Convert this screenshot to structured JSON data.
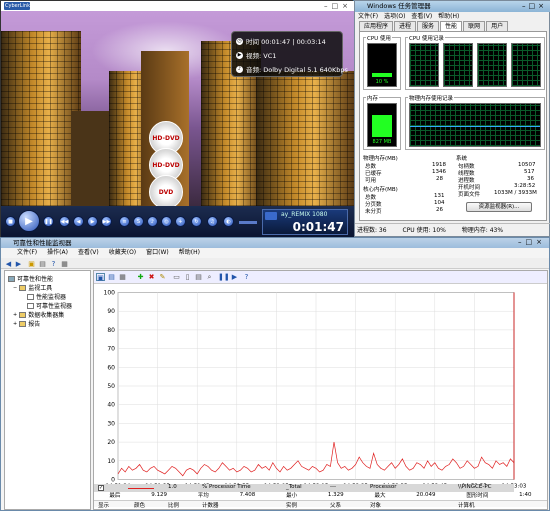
{
  "player": {
    "logo": "CyberLink",
    "osd": {
      "time": "时间 00:01:47 | 00:03:14",
      "video": "视频: VC1",
      "audio": "音频: Dolby Digital 5.1   640Kbps"
    },
    "discs": [
      "HD-DVD",
      "HD-DVD",
      "DVD"
    ],
    "time_panel": {
      "title": "ay_REMIX 1080",
      "time": "0:01:47"
    }
  },
  "taskmgr": {
    "title": "Windows 任务管理器",
    "menu": [
      "文件(F)",
      "选项(O)",
      "查看(V)",
      "帮助(H)"
    ],
    "tabs": [
      "应用程序",
      "进程",
      "服务",
      "性能",
      "联网",
      "用户"
    ],
    "active_tab": "性能",
    "cpu_usage_label": "CPU 使用",
    "cpu_history_label": "CPU 使用记录",
    "cpu_value": "10 %",
    "mem_label": "内存",
    "mem_history_label": "物理内存使用记录",
    "mem_value": "827 MB",
    "phys_mem": {
      "title": "物理内存(MB)",
      "rows": [
        [
          "总数",
          "1918"
        ],
        [
          "已缓存",
          "1346"
        ],
        [
          "可用",
          "28"
        ]
      ]
    },
    "kernel_mem": {
      "title": "核心内存(MB)",
      "rows": [
        [
          "总数",
          "131"
        ],
        [
          "分页数",
          "104"
        ],
        [
          "未分页",
          "26"
        ]
      ]
    },
    "system": {
      "title": "系统",
      "rows": [
        [
          "句柄数",
          "10507"
        ],
        [
          "线程数",
          "517"
        ],
        [
          "进程数",
          "36"
        ],
        [
          "开机时间",
          "3:28:52"
        ],
        [
          "页面文件",
          "1033M / 3933M"
        ]
      ]
    },
    "resmon_button": "资源监视器(R)...",
    "status": [
      "进程数: 36",
      "CPU 使用: 10%",
      "物理内存: 43%"
    ]
  },
  "perfmon": {
    "title": "可靠性和性能监视器",
    "menu": [
      "文件(F)",
      "操作(A)",
      "查看(V)",
      "收藏夹(O)",
      "窗口(W)",
      "帮助(H)"
    ],
    "tree": [
      "可靠性和性能",
      "监视工具",
      "性能监视器",
      "可靠性监视器",
      "数据收集器集",
      "报告"
    ],
    "stats": {
      "last_label": "最后",
      "last": "9.129",
      "avg_label": "平均",
      "avg": "7.408",
      "min_label": "最小",
      "min": "1.329",
      "max_label": "最大",
      "max": "20.049",
      "dur_label": "图形时间",
      "dur": "1:40"
    },
    "legend_headers": [
      "显示",
      "颜色",
      "比例",
      "计数器",
      "实例",
      "父系",
      "对象",
      "计算机"
    ],
    "legend_row": [
      "1.0",
      "% Processor Time",
      "_Total",
      "---",
      "Processor",
      "\\\\PINGCE-PC"
    ]
  },
  "chart_data": {
    "type": "line",
    "ylim": [
      0,
      100
    ],
    "yticks": [
      0,
      10,
      20,
      30,
      40,
      50,
      60,
      70,
      80,
      90,
      100
    ],
    "xticks": [
      "14:51:24",
      "14:51:35",
      "14:51:45",
      "14:51:55",
      "14:52:05",
      "14:52:15",
      "14:52:25",
      "14:52:35",
      "14:52:45",
      "14:52:55",
      "14:53:03"
    ],
    "series": [
      {
        "color": "#e02020",
        "values": [
          3,
          6,
          4,
          7,
          5,
          6,
          8,
          5,
          4,
          6,
          7,
          5,
          4,
          3,
          5,
          7,
          6,
          4,
          2,
          5,
          6,
          5,
          3,
          6,
          8,
          7,
          5,
          4,
          6,
          9,
          7,
          5,
          6,
          4,
          5,
          7,
          6,
          4,
          5,
          8,
          6,
          7,
          5,
          9,
          6,
          4,
          7,
          5,
          6,
          8,
          10,
          7,
          6,
          5,
          7,
          6,
          4,
          5,
          8,
          7,
          20,
          9,
          6,
          7,
          5,
          6,
          8,
          12,
          9,
          7,
          6,
          14,
          8,
          6,
          5,
          7,
          9,
          6,
          8,
          11,
          7,
          5,
          6,
          9,
          8,
          6,
          10,
          7,
          9,
          6,
          5,
          7,
          8,
          11,
          9,
          6,
          7,
          10,
          8,
          6,
          7,
          12,
          9,
          8,
          6,
          10,
          8,
          9,
          7,
          11,
          9
        ]
      }
    ]
  }
}
